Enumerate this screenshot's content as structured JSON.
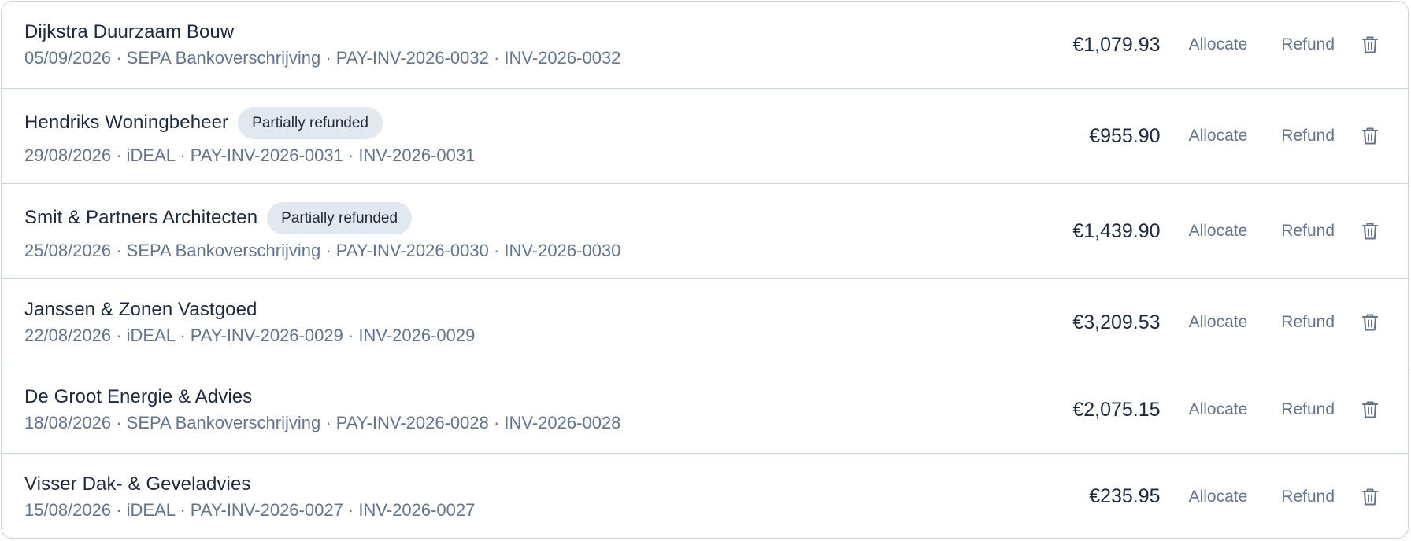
{
  "payments": [
    {
      "customer": "Dijkstra Duurzaam Bouw",
      "badge": "",
      "meta": "05/09/2026 · SEPA Bankoverschrijving · PAY-INV-2026-0032 · INV-2026-0032",
      "amount": "€1,079.93"
    },
    {
      "customer": "Hendriks Woningbeheer",
      "badge": "Partially refunded",
      "meta": "29/08/2026 · iDEAL · PAY-INV-2026-0031 · INV-2026-0031",
      "amount": "€955.90"
    },
    {
      "customer": "Smit & Partners Architecten",
      "badge": "Partially refunded",
      "meta": "25/08/2026 · SEPA Bankoverschrijving · PAY-INV-2026-0030 · INV-2026-0030",
      "amount": "€1,439.90"
    },
    {
      "customer": "Janssen & Zonen Vastgoed",
      "badge": "",
      "meta": "22/08/2026 · iDEAL · PAY-INV-2026-0029 · INV-2026-0029",
      "amount": "€3,209.53"
    },
    {
      "customer": "De Groot Energie & Advies",
      "badge": "",
      "meta": "18/08/2026 · SEPA Bankoverschrijving · PAY-INV-2026-0028 · INV-2026-0028",
      "amount": "€2,075.15"
    },
    {
      "customer": "Visser Dak- & Geveladvies",
      "badge": "",
      "meta": "15/08/2026 · iDEAL · PAY-INV-2026-0027 · INV-2026-0027",
      "amount": "€235.95"
    }
  ],
  "actions": {
    "allocate_label": "Allocate",
    "refund_label": "Refund",
    "delete_icon": "trash-icon"
  },
  "colors": {
    "border": "#cbd5e1",
    "text_primary": "#1e293b",
    "text_muted": "#64748b",
    "badge_bg": "#e2e8f0"
  }
}
